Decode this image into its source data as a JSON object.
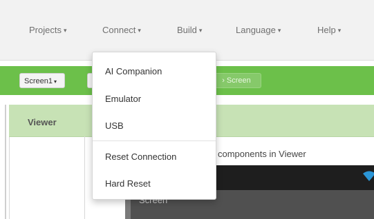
{
  "menubar": {
    "items": [
      {
        "label": "Projects",
        "caret": "▾"
      },
      {
        "label": "Connect",
        "caret": "▾"
      },
      {
        "label": "Build",
        "caret": "▾"
      },
      {
        "label": "Language",
        "caret": "▾"
      },
      {
        "label": "Help",
        "caret": "▾"
      }
    ]
  },
  "toolbar": {
    "screen_select": "Screen1",
    "screen_caret": "▾",
    "remove_screen_label": "› Screen"
  },
  "viewer": {
    "header": "Viewer",
    "hidden_components_text": "components in Viewer",
    "screen_title": "Screen"
  },
  "connect_menu": {
    "items": [
      {
        "label": "AI Companion"
      },
      {
        "label": "Emulator"
      },
      {
        "label": "USB"
      },
      {
        "label": "Reset Connection"
      },
      {
        "label": "Hard Reset"
      }
    ]
  },
  "colors": {
    "accent_green": "#6cc04a",
    "viewer_header": "#c7e2b5",
    "phone_dark": "#1e1e1e",
    "wifi_blue": "#2b95d6"
  },
  "icons": {
    "wifi": "wifi-icon"
  }
}
